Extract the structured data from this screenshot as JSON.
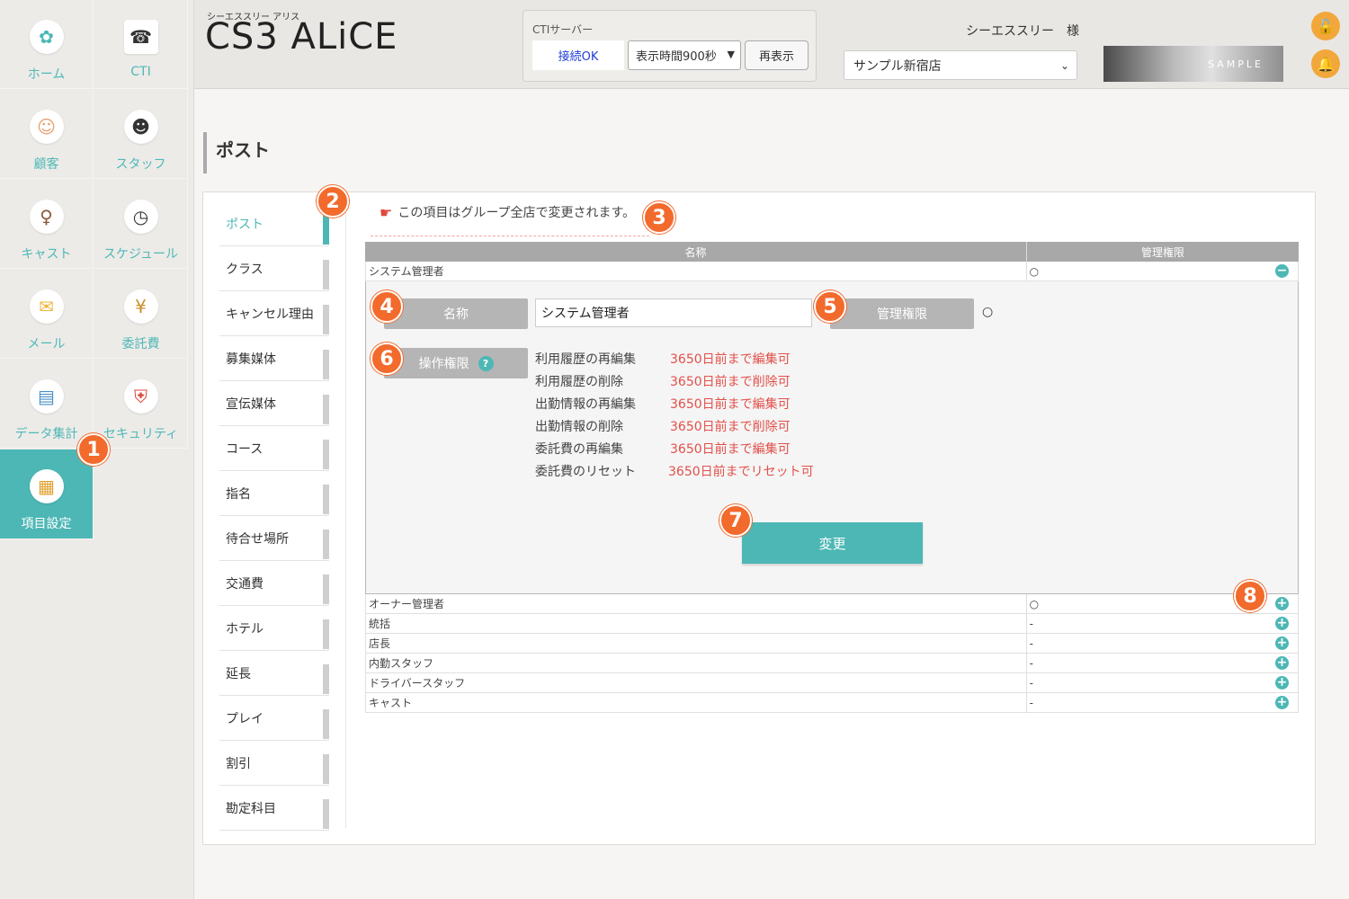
{
  "sidebar": {
    "items": [
      {
        "label": "ホーム",
        "icon": "home-icon",
        "glyph": "✿"
      },
      {
        "label": "CTI",
        "icon": "phone-icon",
        "glyph": "☎"
      },
      {
        "label": "顧客",
        "icon": "customer-icon",
        "glyph": "☺"
      },
      {
        "label": "スタッフ",
        "icon": "staff-icon",
        "glyph": "☻"
      },
      {
        "label": "キャスト",
        "icon": "cast-icon",
        "glyph": "♀"
      },
      {
        "label": "スケジュール",
        "icon": "clock-icon",
        "glyph": "◷"
      },
      {
        "label": "メール",
        "icon": "mail-icon",
        "glyph": "✉"
      },
      {
        "label": "委託費",
        "icon": "wallet-icon",
        "glyph": "¥"
      },
      {
        "label": "データ集計",
        "icon": "report-icon",
        "glyph": "▤"
      },
      {
        "label": "セキュリティ",
        "icon": "shield-icon",
        "glyph": "⛨"
      },
      {
        "label": "項目設定",
        "icon": "clipboard-icon",
        "glyph": "▦"
      }
    ]
  },
  "header": {
    "brand_sub": "シーエススリー アリス",
    "brand": "CS3 ALiCE",
    "cti_label": "CTIサーバー",
    "cti_status": "接続OK",
    "display_time": "表示時間900秒",
    "refresh": "再表示",
    "user": "シーエススリー　様",
    "store": "サンプル新宿店",
    "banner_text": "SAMPLE"
  },
  "page_title": "ポスト",
  "subnav": [
    "ポスト",
    "クラス",
    "キャンセル理由",
    "募集媒体",
    "宣伝媒体",
    "コース",
    "指名",
    "待合せ場所",
    "交通費",
    "ホテル",
    "延長",
    "プレイ",
    "割引",
    "勘定科目"
  ],
  "note": "この項目はグループ全店で変更されます。",
  "table": {
    "headers": {
      "name": "名称",
      "admin": "管理権限"
    },
    "expanded_row": {
      "name": "システム管理者",
      "admin": "○"
    },
    "rows": [
      {
        "name": "オーナー管理者",
        "admin": "○"
      },
      {
        "name": "統括",
        "admin": "-"
      },
      {
        "name": "店長",
        "admin": "-"
      },
      {
        "name": "内勤スタッフ",
        "admin": "-"
      },
      {
        "name": "ドライバースタッフ",
        "admin": "-"
      },
      {
        "name": "キャスト",
        "admin": "-"
      }
    ]
  },
  "edit": {
    "name_label": "名称",
    "name_value": "システム管理者",
    "admin_label": "管理権限",
    "admin_value": "○",
    "ops_label": "操作権限",
    "help": "?",
    "ops": [
      {
        "label": "利用履歴の再編集",
        "value": "3650日前まで編集可"
      },
      {
        "label": "利用履歴の削除",
        "value": "3650日前まで削除可"
      },
      {
        "label": "出勤情報の再編集",
        "value": "3650日前まで編集可"
      },
      {
        "label": "出勤情報の削除",
        "value": "3650日前まで削除可"
      },
      {
        "label": "委託費の再編集",
        "value": "3650日前まで編集可"
      },
      {
        "label": "委託費のリセット",
        "value": "3650日前までリセット可"
      }
    ],
    "change": "変更"
  },
  "badges": [
    "1",
    "2",
    "3",
    "4",
    "5",
    "6",
    "7",
    "8"
  ],
  "colors": {
    "accent": "#4db7b5",
    "badge": "#f26a2c",
    "warn_text": "#e2504a"
  }
}
